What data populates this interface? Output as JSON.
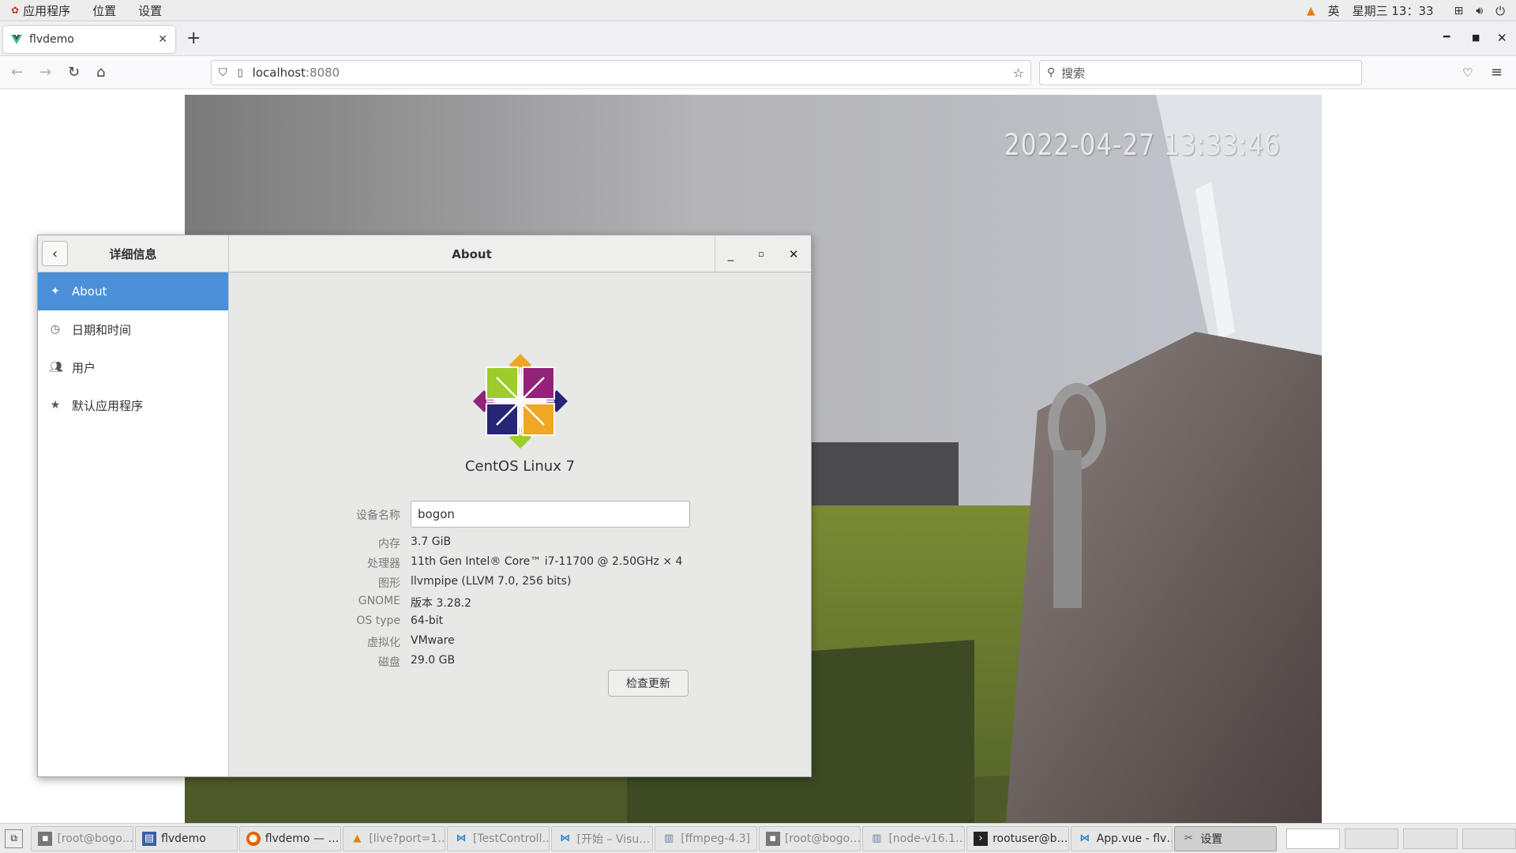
{
  "topbar": {
    "apps_label": "应用程序",
    "places_label": "位置",
    "settings_label": "设置",
    "input_method": "英",
    "clock": "星期三 13：33"
  },
  "browser": {
    "tab_title": "flvdemo",
    "url_host": "localhost",
    "url_port": ":8080",
    "search_placeholder": "搜索"
  },
  "video": {
    "timestamp": "2022-04-27 13:33:46"
  },
  "settings": {
    "sidebar_title": "详细信息",
    "main_title": "About",
    "sidebar_items": [
      {
        "label": "About",
        "icon": "sparkle-icon"
      },
      {
        "label": "日期和时间",
        "icon": "clock-icon"
      },
      {
        "label": "用户",
        "icon": "users-icon"
      },
      {
        "label": "默认应用程序",
        "icon": "star-icon"
      }
    ],
    "os_name": "CentOS Linux 7",
    "device_name_label": "设备名称",
    "device_name": "bogon",
    "memory_label": "内存",
    "memory": "3.7 GiB",
    "processor_label": "处理器",
    "processor": "11th Gen Intel® Core™ i7-11700 @ 2.50GHz × 4",
    "graphics_label": "图形",
    "graphics": "llvmpipe (LLVM 7.0, 256 bits)",
    "gnome_label": "GNOME",
    "gnome": "版本 3.28.2",
    "os_type_label": "OS type",
    "os_type": "64-bit",
    "virtualization_label": "虚拟化",
    "virtualization": "VMware",
    "disk_label": "磁盘",
    "disk": "29.0 GB",
    "update_button": "检查更新"
  },
  "taskbar": {
    "items": [
      {
        "label": "[root@bogo…",
        "icon": "terminal-icon",
        "state": "min"
      },
      {
        "label": "flvdemo",
        "icon": "window-icon",
        "state": "normal"
      },
      {
        "label": "flvdemo — …",
        "icon": "firefox-icon",
        "state": "normal"
      },
      {
        "label": "[live?port=1…",
        "icon": "vlc-icon",
        "state": "min"
      },
      {
        "label": "[TestControll…",
        "icon": "vscode-icon",
        "state": "min"
      },
      {
        "label": "[开始 – Visu…",
        "icon": "vscode-icon",
        "state": "min"
      },
      {
        "label": "[ffmpeg-4.3]",
        "icon": "folder-icon",
        "state": "min"
      },
      {
        "label": "[root@bogo…",
        "icon": "terminal-icon",
        "state": "min"
      },
      {
        "label": "[node-v16.1…",
        "icon": "folder-icon",
        "state": "min"
      },
      {
        "label": "rootuser@b…",
        "icon": "terminal-icon",
        "state": "normal"
      },
      {
        "label": "App.vue - flv…",
        "icon": "vscode-icon",
        "state": "normal"
      },
      {
        "label": "设置",
        "icon": "settings-icon",
        "state": "active"
      }
    ]
  },
  "colors": {
    "accent": "#4a90d9",
    "centos_green": "#9ccd2a",
    "centos_orange": "#efa724",
    "centos_purple": "#932279",
    "centos_navy": "#262577"
  }
}
